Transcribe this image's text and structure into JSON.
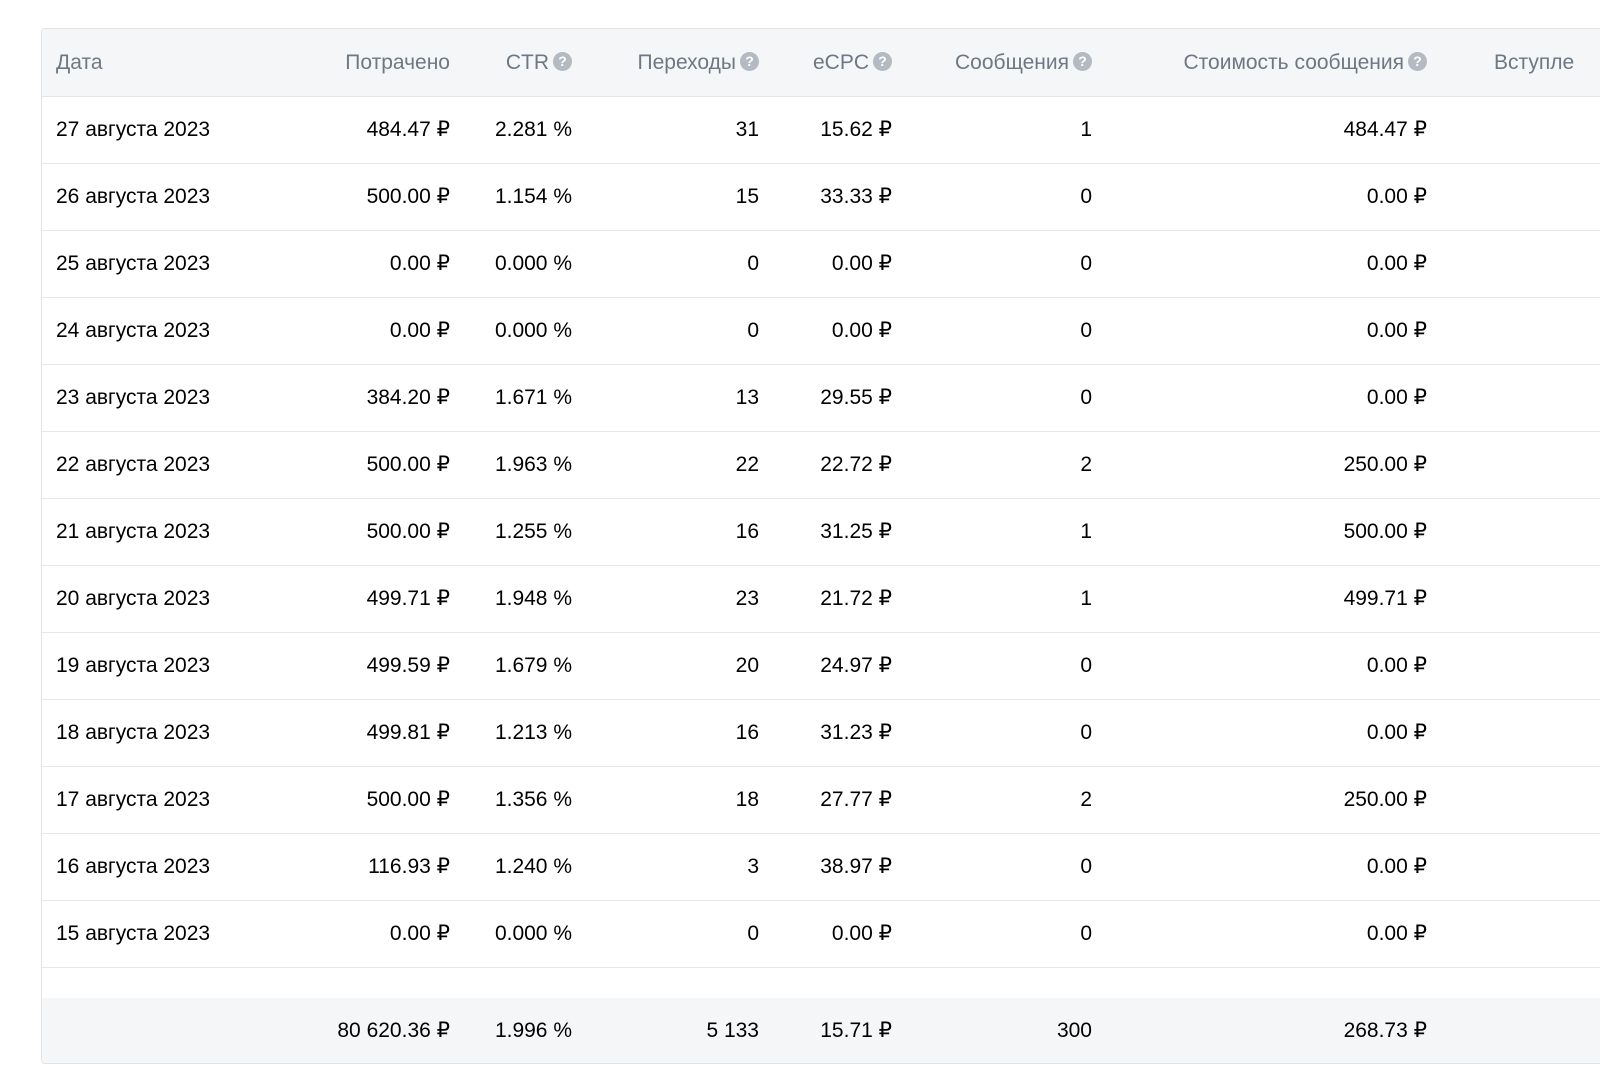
{
  "columns": {
    "date": "Дата",
    "spent": "Потрачено",
    "ctr": "CTR",
    "clicks": "Переходы",
    "ecpc": "eCPC",
    "messages": "Сообщения",
    "message_cost": "Стоимость сообщения",
    "joins": "Вступле",
    "help_glyph": "?"
  },
  "rows": [
    {
      "date": "27 августа 2023",
      "spent": "484.47 ₽",
      "ctr": "2.281 %",
      "clicks": "31",
      "ecpc": "15.62 ₽",
      "messages": "1",
      "message_cost": "484.47 ₽"
    },
    {
      "date": "26 августа 2023",
      "spent": "500.00 ₽",
      "ctr": "1.154 %",
      "clicks": "15",
      "ecpc": "33.33 ₽",
      "messages": "0",
      "message_cost": "0.00 ₽"
    },
    {
      "date": "25 августа 2023",
      "spent": "0.00 ₽",
      "ctr": "0.000 %",
      "clicks": "0",
      "ecpc": "0.00 ₽",
      "messages": "0",
      "message_cost": "0.00 ₽"
    },
    {
      "date": "24 августа 2023",
      "spent": "0.00 ₽",
      "ctr": "0.000 %",
      "clicks": "0",
      "ecpc": "0.00 ₽",
      "messages": "0",
      "message_cost": "0.00 ₽"
    },
    {
      "date": "23 августа 2023",
      "spent": "384.20 ₽",
      "ctr": "1.671 %",
      "clicks": "13",
      "ecpc": "29.55 ₽",
      "messages": "0",
      "message_cost": "0.00 ₽"
    },
    {
      "date": "22 августа 2023",
      "spent": "500.00 ₽",
      "ctr": "1.963 %",
      "clicks": "22",
      "ecpc": "22.72 ₽",
      "messages": "2",
      "message_cost": "250.00 ₽"
    },
    {
      "date": "21 августа 2023",
      "spent": "500.00 ₽",
      "ctr": "1.255 %",
      "clicks": "16",
      "ecpc": "31.25 ₽",
      "messages": "1",
      "message_cost": "500.00 ₽"
    },
    {
      "date": "20 августа 2023",
      "spent": "499.71 ₽",
      "ctr": "1.948 %",
      "clicks": "23",
      "ecpc": "21.72 ₽",
      "messages": "1",
      "message_cost": "499.71 ₽"
    },
    {
      "date": "19 августа 2023",
      "spent": "499.59 ₽",
      "ctr": "1.679 %",
      "clicks": "20",
      "ecpc": "24.97 ₽",
      "messages": "0",
      "message_cost": "0.00 ₽"
    },
    {
      "date": "18 августа 2023",
      "spent": "499.81 ₽",
      "ctr": "1.213 %",
      "clicks": "16",
      "ecpc": "31.23 ₽",
      "messages": "0",
      "message_cost": "0.00 ₽"
    },
    {
      "date": "17 августа 2023",
      "spent": "500.00 ₽",
      "ctr": "1.356 %",
      "clicks": "18",
      "ecpc": "27.77 ₽",
      "messages": "2",
      "message_cost": "250.00 ₽"
    },
    {
      "date": "16 августа 2023",
      "spent": "116.93 ₽",
      "ctr": "1.240 %",
      "clicks": "3",
      "ecpc": "38.97 ₽",
      "messages": "0",
      "message_cost": "0.00 ₽"
    },
    {
      "date": "15 августа 2023",
      "spent": "0.00 ₽",
      "ctr": "0.000 %",
      "clicks": "0",
      "ecpc": "0.00 ₽",
      "messages": "0",
      "message_cost": "0.00 ₽"
    }
  ],
  "totals": {
    "spent": "80 620.36 ₽",
    "ctr": "1.996 %",
    "clicks": "5 133",
    "ecpc": "15.71 ₽",
    "messages": "300",
    "message_cost": "268.73 ₽"
  }
}
